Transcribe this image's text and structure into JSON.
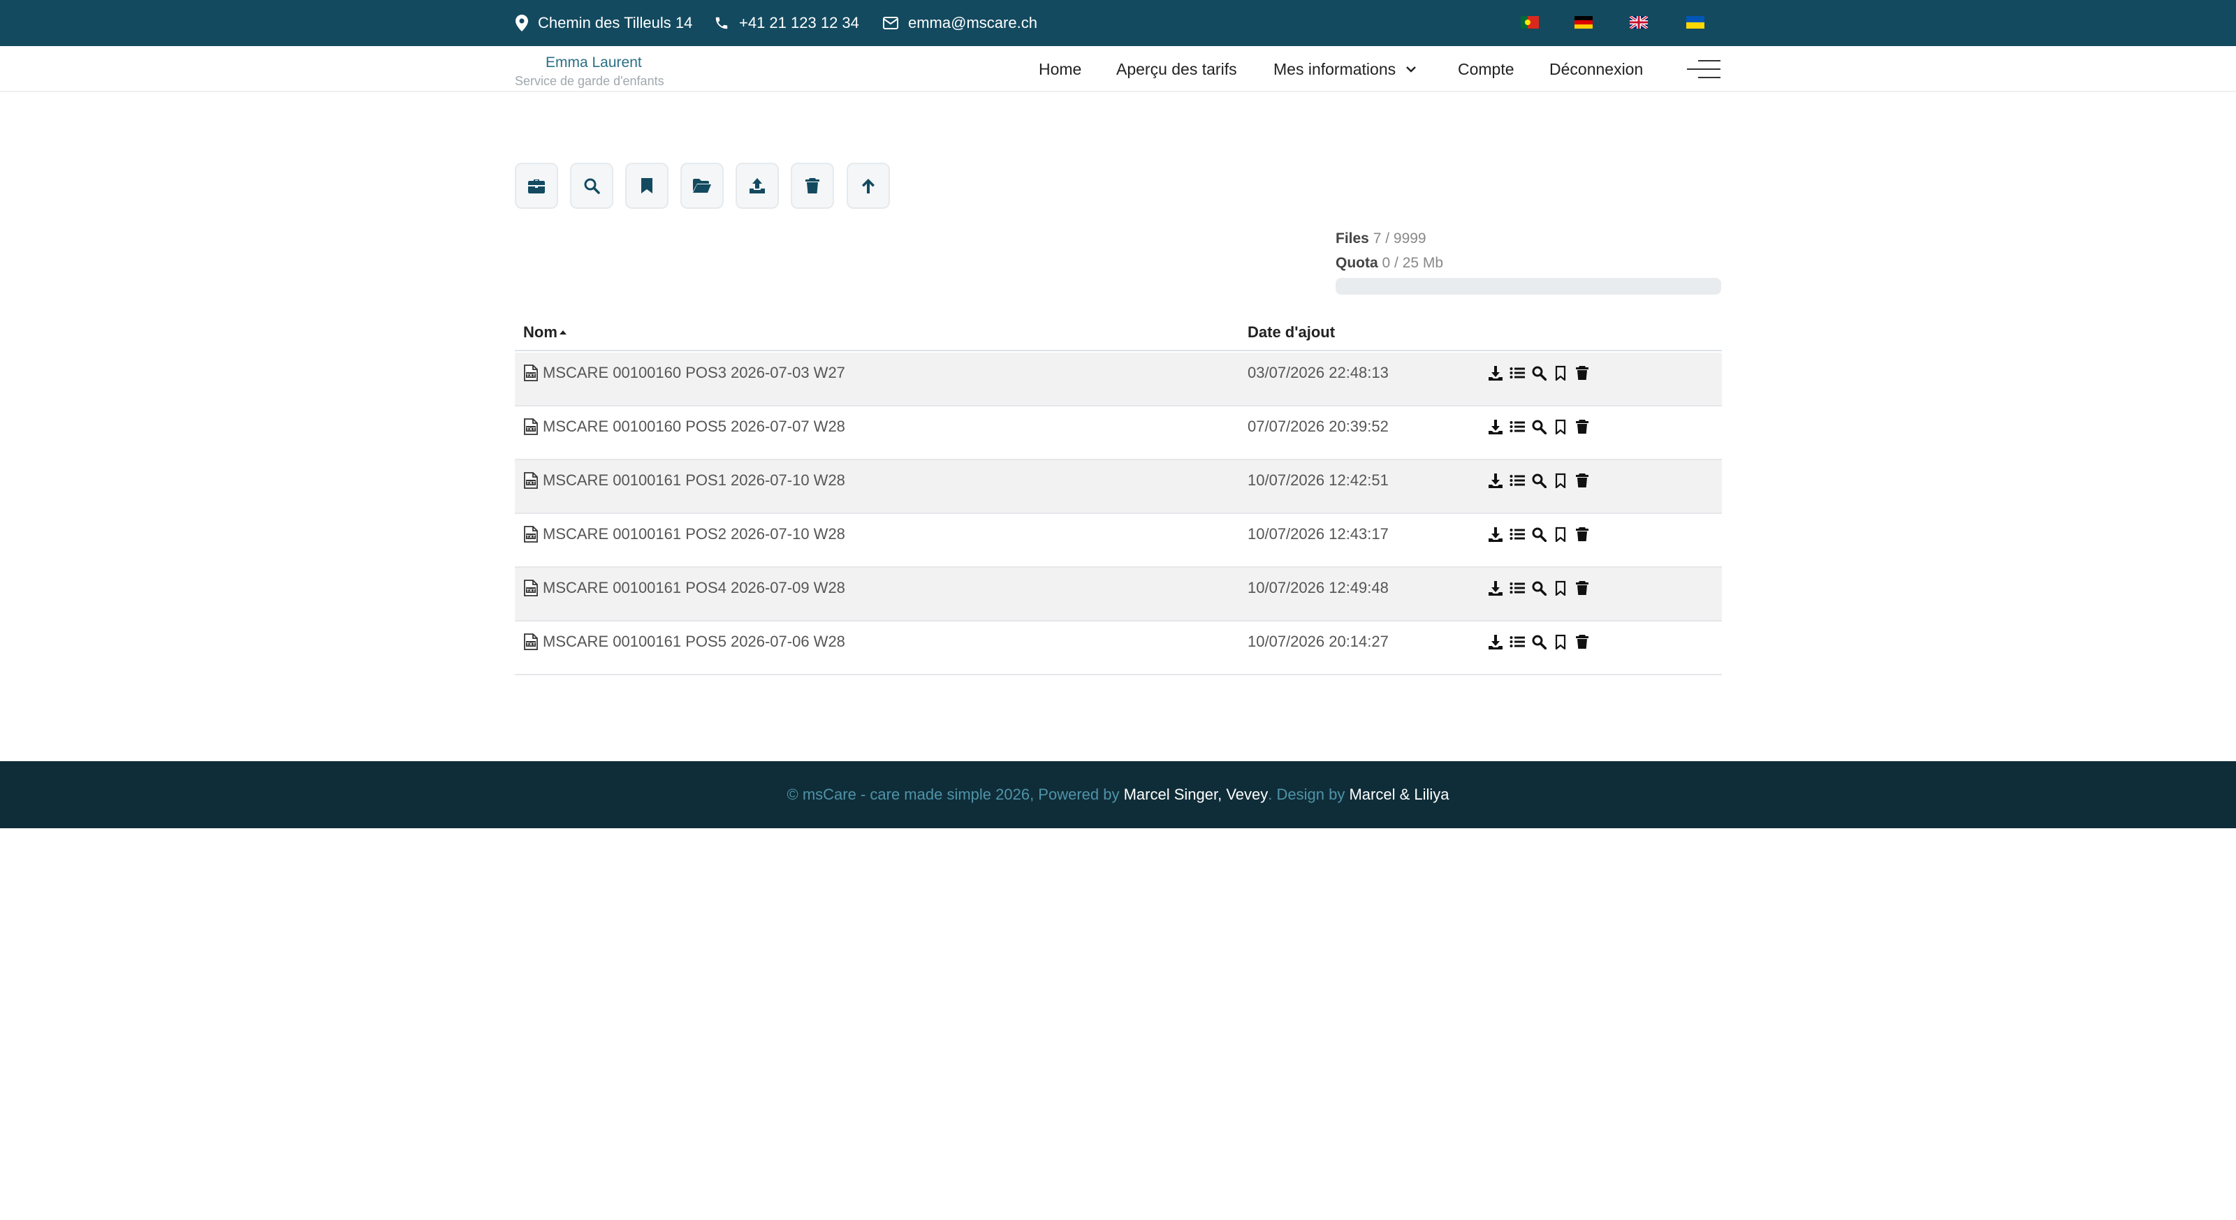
{
  "topbar": {
    "address": "Chemin des Tilleuls 14",
    "phone": "+41 21 123 12 34",
    "email": "emma@mscare.ch",
    "flags": [
      "portugal-flag",
      "germany-flag",
      "uk-flag",
      "ukraine-flag"
    ]
  },
  "brand": {
    "name": "Emma Laurent",
    "subtitle": "Service de garde d'enfants"
  },
  "nav": {
    "home": "Home",
    "pricing": "Aperçu des tarifs",
    "my_info": "Mes informations",
    "account": "Compte",
    "logout": "Déconnexion"
  },
  "toolbar": [
    "briefcase-icon",
    "search-icon",
    "bookmark-icon",
    "folder-open-icon",
    "upload-icon",
    "trash-icon",
    "arrow-up-icon"
  ],
  "stats": {
    "files_label": "Files",
    "files_value": "7 / 9999",
    "quota_label": "Quota",
    "quota_value": "0 / 25 Mb",
    "quota_fraction": 0
  },
  "table": {
    "col_name": "Nom",
    "col_date": "Date d'ajout",
    "rows": [
      {
        "name": "MSCARE 00100160 POS3 2026-07-03 W27",
        "date": "03/07/2026 22:48:13"
      },
      {
        "name": "MSCARE 00100160 POS5 2026-07-07 W28",
        "date": "07/07/2026 20:39:52"
      },
      {
        "name": "MSCARE 00100161 POS1 2026-07-10 W28",
        "date": "10/07/2026 12:42:51"
      },
      {
        "name": "MSCARE 00100161 POS2 2026-07-10 W28",
        "date": "10/07/2026 12:43:17"
      },
      {
        "name": "MSCARE 00100161 POS4 2026-07-09 W28",
        "date": "10/07/2026 12:49:48"
      },
      {
        "name": "MSCARE 00100161 POS5 2026-07-06 W28",
        "date": "10/07/2026 20:14:27"
      }
    ]
  },
  "footer": {
    "prefix": "© msCare - care made simple 2026, Powered by",
    "powered": "Marcel Singer, Vevey",
    "design_prefix": ". Design by",
    "designer": "Marcel & Liliya"
  },
  "colors": {
    "topbar": "#134a5f",
    "footer": "#0f2d38",
    "accent": "#2a6f86"
  }
}
